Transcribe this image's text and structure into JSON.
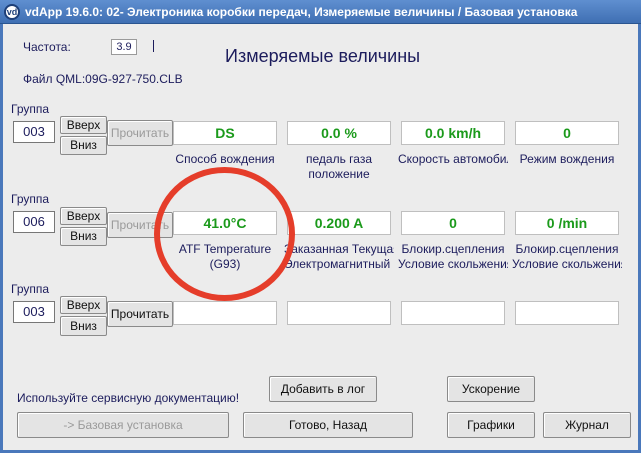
{
  "window": {
    "title": "vdApp 19.6.0: 02- Электроника коробки передач,  Измеряемые величины / Базовая установка",
    "icon_text": "vd"
  },
  "header": {
    "freq_label": "Частота:",
    "freq_value": "3.9",
    "file_label": "Файл QML:09G-927-750.CLB",
    "main_title": "Измеряемые величины"
  },
  "groups": [
    {
      "label": "Группа",
      "number": "003",
      "up_label": "Вверх",
      "down_label": "Вниз",
      "read_label": "Прочитать",
      "read_enabled": false,
      "values": [
        "DS",
        "0.0 %",
        "0.0 km/h",
        "0"
      ],
      "descriptions": [
        [
          "Способ вождения"
        ],
        [
          "педаль газа",
          "положение"
        ],
        [
          "Скорость автомобиля"
        ],
        [
          "Режим вождения"
        ]
      ]
    },
    {
      "label": "Группа",
      "number": "006",
      "up_label": "Вверх",
      "down_label": "Вниз",
      "read_label": "Прочитать",
      "read_enabled": false,
      "values": [
        "41.0°C",
        "0.200 A",
        "0",
        "0 /min"
      ],
      "descriptions": [
        [
          "ATF Temperature",
          "(G93)"
        ],
        [
          "Заказанная Текущая",
          "Электромагнитный клапан"
        ],
        [
          "Блокир.сцепления",
          "Условие скольжения"
        ],
        [
          "Блокир.сцепления",
          "Условие скольжения"
        ]
      ]
    },
    {
      "label": "Группа",
      "number": "003",
      "up_label": "Вверх",
      "down_label": "Вниз",
      "read_label": "Прочитать",
      "read_enabled": true,
      "values": [
        "",
        "",
        "",
        ""
      ],
      "descriptions": [
        [],
        [],
        [],
        []
      ]
    }
  ],
  "footer": {
    "service_doc_text": "Используйте сервисную документацию!",
    "add_log_label": "Добавить в лог",
    "accel_label": "Ускорение",
    "basic_setting_label": "-> Базовая установка",
    "done_back_label": "Готово, Назад",
    "graphs_label": "Графики",
    "journal_label": "Журнал"
  },
  "colors": {
    "value_text": "#1b9a1b",
    "highlight_circle": "#e53d2a",
    "title_bar": "#4a78bb"
  }
}
